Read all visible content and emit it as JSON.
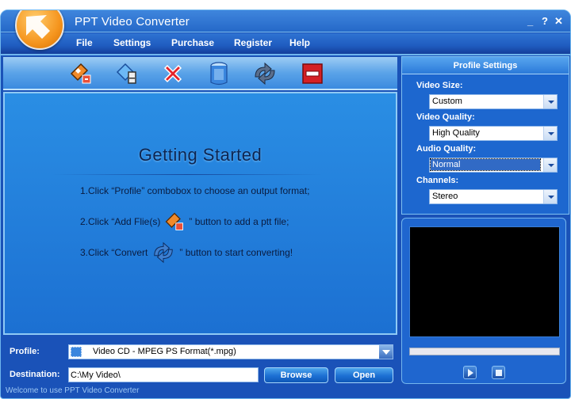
{
  "window": {
    "title": "PPT Video Converter",
    "controls": {
      "minimize": "_",
      "help": "?",
      "close": "✕"
    }
  },
  "menu": {
    "items": [
      {
        "label": "File"
      },
      {
        "label": "Settings"
      },
      {
        "label": "Purchase"
      },
      {
        "label": "Register"
      },
      {
        "label": "Help"
      }
    ]
  },
  "toolbar": {
    "tools": [
      {
        "icon": "add-file-icon",
        "tooltip": "Add File(s)"
      },
      {
        "icon": "add-folder-icon",
        "tooltip": "Add Folder"
      },
      {
        "icon": "delete-icon",
        "tooltip": "Remove"
      },
      {
        "icon": "trash-icon",
        "tooltip": "Clear"
      },
      {
        "icon": "convert-icon",
        "tooltip": "Convert"
      },
      {
        "icon": "stop-icon",
        "tooltip": "Stop"
      }
    ]
  },
  "getting_started": {
    "title": "Getting Started",
    "step1": "1.Click “Profile” combobox to choose an output format;",
    "step2_before": "2.Click “Add Flie(s)",
    "step2_after": "” button to add a ptt file;",
    "step3_before": "3.Click “Convert",
    "step3_after": "” button to start converting!"
  },
  "bottom": {
    "profile_label": "Profile:",
    "profile_value": "Video CD - MPEG PS Format(*.mpg)",
    "destination_label": "Destination:",
    "destination_value": "C:\\My Video\\",
    "browse_label": "Browse",
    "open_label": "Open",
    "status": "Welcome to use PPT Video Converter"
  },
  "profile_settings": {
    "title": "Profile Settings",
    "video_size_label": "Video Size:",
    "video_size_value": "Custom",
    "video_quality_label": "Video Quality:",
    "video_quality_value": "High Quality",
    "audio_quality_label": "Audio Quality:",
    "audio_quality_value": "Normal",
    "channels_label": "Channels:",
    "channels_value": "Stereo"
  },
  "player": {
    "progress": 0
  },
  "colors": {
    "accent": "#1a52b8",
    "highlight": "#316ac5"
  }
}
